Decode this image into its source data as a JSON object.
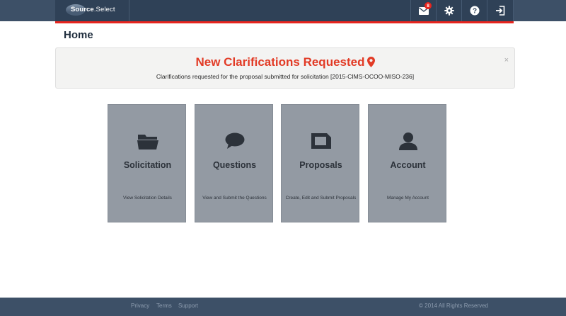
{
  "app": {
    "logo_bold": "Source",
    "logo_rest": ".Select"
  },
  "nav": {
    "mail_badge": "8",
    "icons": [
      "envelope-icon",
      "gear-icon",
      "question-icon",
      "sign-out-icon"
    ]
  },
  "page": {
    "title": "Home"
  },
  "alert": {
    "title": "New Clarifications Requested",
    "message": "Clarifications requested for the proposal submitted for solicitation [2015-CIMS-OCOO-MISO-236]",
    "close": "×"
  },
  "tiles": [
    {
      "icon": "folder-icon",
      "title": "Solicitation",
      "subtitle": "View Solicitation Details"
    },
    {
      "icon": "comment-icon",
      "title": "Questions",
      "subtitle": "View and Submit the Questions"
    },
    {
      "icon": "proposal-icon",
      "title": "Proposals",
      "subtitle": "Create, Edit and Submit Proposals"
    },
    {
      "icon": "user-icon",
      "title": "Account",
      "subtitle": "Manage My Account"
    }
  ],
  "footer": {
    "links": [
      "Privacy",
      "Terms",
      "Support"
    ],
    "copyright": "© 2014 All Rights Reserved"
  },
  "colors": {
    "navbar": "#2f4157",
    "accent_red": "#e8251e",
    "alert_title": "#e23b26",
    "tile": "#939aa3"
  }
}
